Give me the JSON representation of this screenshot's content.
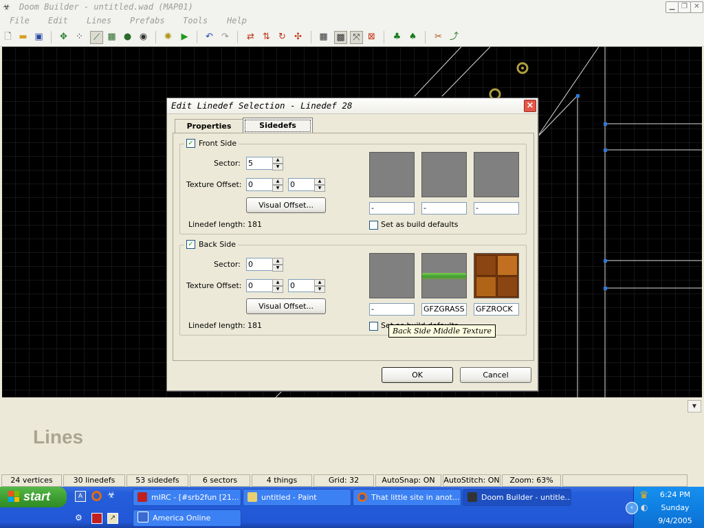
{
  "window": {
    "title": "Doom Builder - untitled.wad (MAP01)"
  },
  "menu": [
    "File",
    "Edit",
    "Lines",
    "Prefabs",
    "Tools",
    "Help"
  ],
  "mode_label": "Lines",
  "status": {
    "vertices": "24 vertices",
    "linedefs": "30 linedefs",
    "sidedefs": "53 sidedefs",
    "sectors": "6 sectors",
    "things": "4 things",
    "grid": "Grid: 32",
    "autosnap": "AutoSnap: ON",
    "autostitch": "AutoStitch: ON",
    "zoom": "Zoom: 63%"
  },
  "dialog": {
    "title": "Edit Linedef Selection - Linedef 28",
    "tabs": [
      "Properties",
      "Sidedefs"
    ],
    "front": {
      "legend": "Front Side",
      "checked": true,
      "sector_label": "Sector:",
      "sector": "5",
      "offset_label": "Texture Offset:",
      "offset_x": "0",
      "offset_y": "0",
      "visual_offset": "Visual Offset...",
      "length_label": "Linedef length:",
      "length": "181",
      "tex_upper": "-",
      "tex_middle": "-",
      "tex_lower": "-",
      "build_defaults": "Set as build defaults"
    },
    "back": {
      "legend": "Back Side",
      "checked": true,
      "sector_label": "Sector:",
      "sector": "0",
      "offset_label": "Texture Offset:",
      "offset_x": "0",
      "offset_y": "0",
      "visual_offset": "Visual Offset...",
      "length_label": "Linedef length:",
      "length": "181",
      "tex_upper": "-",
      "tex_middle": "GFZGRASS",
      "tex_lower": "GFZROCK",
      "build_defaults": "Set as build defaults"
    },
    "tooltip": "Back Side Middle Texture",
    "ok": "OK",
    "cancel": "Cancel"
  },
  "taskbar": {
    "start": "start",
    "tasks": [
      "mIRC - [#srb2fun [21...",
      "untitled - Paint",
      "That little site in anot...",
      "Doom Builder - untitle...",
      "America Online"
    ],
    "clock": {
      "time": "6:24 PM",
      "day": "Sunday",
      "date": "9/4/2005"
    }
  }
}
